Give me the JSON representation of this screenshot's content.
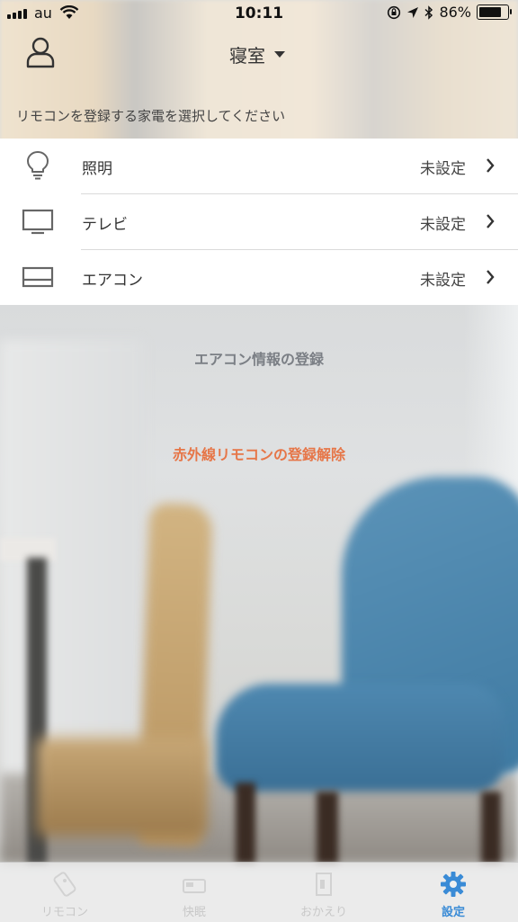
{
  "status_bar": {
    "carrier": "au",
    "time": "10:11",
    "battery": "86%",
    "battery_level": 0.86,
    "icons": [
      "signal-icon",
      "wifi-icon",
      "rotation-lock-icon",
      "location-icon",
      "bluetooth-icon",
      "battery-icon"
    ]
  },
  "header": {
    "profile_icon": "person-icon",
    "room": "寝室",
    "instruction": "リモコンを登録する家電を選択してください"
  },
  "devices": [
    {
      "icon": "lightbulb-icon",
      "label": "照明",
      "status": "未設定"
    },
    {
      "icon": "tv-icon",
      "label": "テレビ",
      "status": "未設定"
    },
    {
      "icon": "aircon-icon",
      "label": "エアコン",
      "status": "未設定"
    }
  ],
  "actions": {
    "aircon_info": "エアコン情報の登録",
    "unregister_ir": "赤外線リモコンの登録解除"
  },
  "colors": {
    "accent": "#3a8bd6",
    "danger": "#e67648",
    "muted": "#7b7f85"
  },
  "tabs": [
    {
      "icon": "remote-icon",
      "label": "リモコン",
      "active": false
    },
    {
      "icon": "sleep-icon",
      "label": "快眠",
      "active": false
    },
    {
      "icon": "door-icon",
      "label": "おかえり",
      "active": false
    },
    {
      "icon": "gear-icon",
      "label": "設定",
      "active": true
    }
  ]
}
